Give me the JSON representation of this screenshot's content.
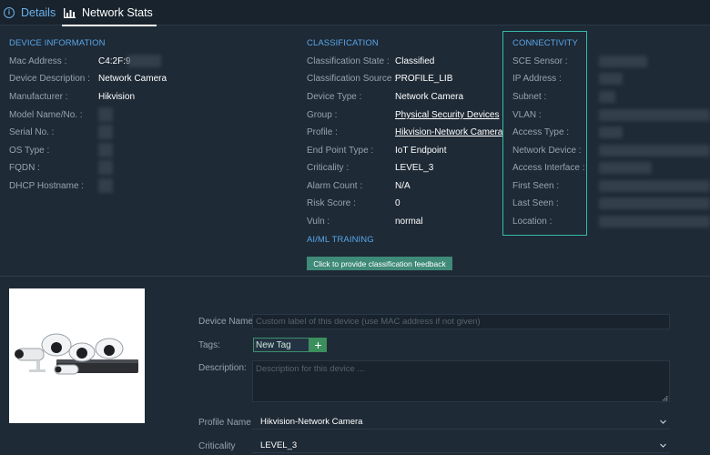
{
  "tabs": {
    "details": "Details",
    "network_stats": "Network Stats"
  },
  "device_information": {
    "title": "DEVICE INFORMATION",
    "fields": [
      {
        "label": "Mac Address :",
        "value": "C4:2F:9"
      },
      {
        "label": "Device Description :",
        "value": "Network Camera"
      },
      {
        "label": "Manufacturer :",
        "value": "Hikvision"
      },
      {
        "label": "Model Name/No. :",
        "value": ""
      },
      {
        "label": "Serial No. :",
        "value": ""
      },
      {
        "label": "OS Type :",
        "value": ""
      },
      {
        "label": "FQDN :",
        "value": ""
      },
      {
        "label": "DHCP Hostname :",
        "value": ""
      }
    ]
  },
  "classification": {
    "title": "CLASSIFICATION",
    "fields": [
      {
        "label": "Classification State :",
        "value": "Classified"
      },
      {
        "label": "Classification Source :",
        "value": "PROFILE_LIB"
      },
      {
        "label": "Device Type :",
        "value": "Network Camera"
      },
      {
        "label": "Group :",
        "value": "Physical Security Devices"
      },
      {
        "label": "Profile :",
        "value": "Hikvision-Network Camera"
      },
      {
        "label": "End Point Type :",
        "value": "IoT Endpoint"
      },
      {
        "label": "Criticality :",
        "value": "LEVEL_3"
      },
      {
        "label": "Alarm Count :",
        "value": "N/A"
      },
      {
        "label": "Risk Score :",
        "value": "0"
      },
      {
        "label": "Vuln :",
        "value": "normal"
      }
    ],
    "aiml_title": "AI/ML TRAINING",
    "feedback_button": "Click to provide classification feedback"
  },
  "connectivity": {
    "title": "CONNECTIVITY",
    "fields": [
      {
        "label": "SCE Sensor :"
      },
      {
        "label": "IP Address :"
      },
      {
        "label": "Subnet :"
      },
      {
        "label": "VLAN :"
      },
      {
        "label": "Access Type :"
      },
      {
        "label": "Network Device :"
      },
      {
        "label": "Access Interface :"
      },
      {
        "label": "First Seen :"
      },
      {
        "label": "Last Seen :"
      },
      {
        "label": "Location :"
      }
    ]
  },
  "form": {
    "device_name_label": "Device Name:",
    "device_name_placeholder": "Custom label of this device (use MAC address if not given)",
    "tags_label": "Tags:",
    "new_tag": "New Tag",
    "add_tag": "+",
    "description_label": "Description:",
    "description_placeholder": "Description for this device ...",
    "profile_name_label": "Profile Name",
    "profile_name_value": "Hikvision-Network Camera",
    "criticality_label": "Criticality",
    "criticality_value": "LEVEL_3"
  },
  "icons": {
    "details_tab": "info-circle-icon",
    "stats_tab": "bar-chart-icon",
    "dropdown": "chevron-down-icon",
    "add": "plus-icon"
  },
  "colors": {
    "background": "#1e2a36",
    "section_title": "#5aa6e8",
    "connectivity_border": "#36b8a6",
    "feedback_button": "#3f8a78",
    "tag_add": "#3c8f5c"
  }
}
